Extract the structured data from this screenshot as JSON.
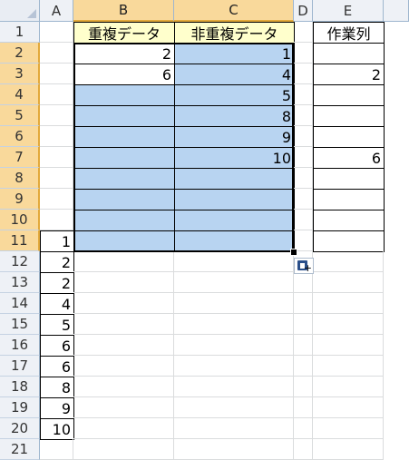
{
  "columns": [
    "A",
    "B",
    "C",
    "D",
    "E"
  ],
  "headers": {
    "b1": "重複データ",
    "c1": "非重複データ",
    "e1": "作業列"
  },
  "rows": [
    "1",
    "2",
    "3",
    "4",
    "5",
    "6",
    "7",
    "8",
    "9",
    "10",
    "11",
    "12",
    "13",
    "14",
    "15",
    "16",
    "17",
    "18",
    "19",
    "20",
    "21"
  ],
  "column_a": [
    "",
    "",
    "",
    "",
    "",
    "",
    "",
    "",
    "",
    "",
    "1",
    "2",
    "2",
    "4",
    "5",
    "6",
    "6",
    "8",
    "9",
    "10",
    ""
  ],
  "column_b": [
    "",
    "2",
    "6",
    "",
    "",
    "",
    "",
    "",
    "",
    "",
    ""
  ],
  "column_c": [
    "",
    "1",
    "4",
    "5",
    "8",
    "9",
    "10",
    "",
    "",
    "",
    ""
  ],
  "column_e": [
    "",
    "",
    "2",
    "",
    "",
    "",
    "6",
    "",
    "",
    "",
    ""
  ],
  "selection": {
    "range": "B2:C11"
  },
  "paste_options_icon": "paste-options-icon"
}
